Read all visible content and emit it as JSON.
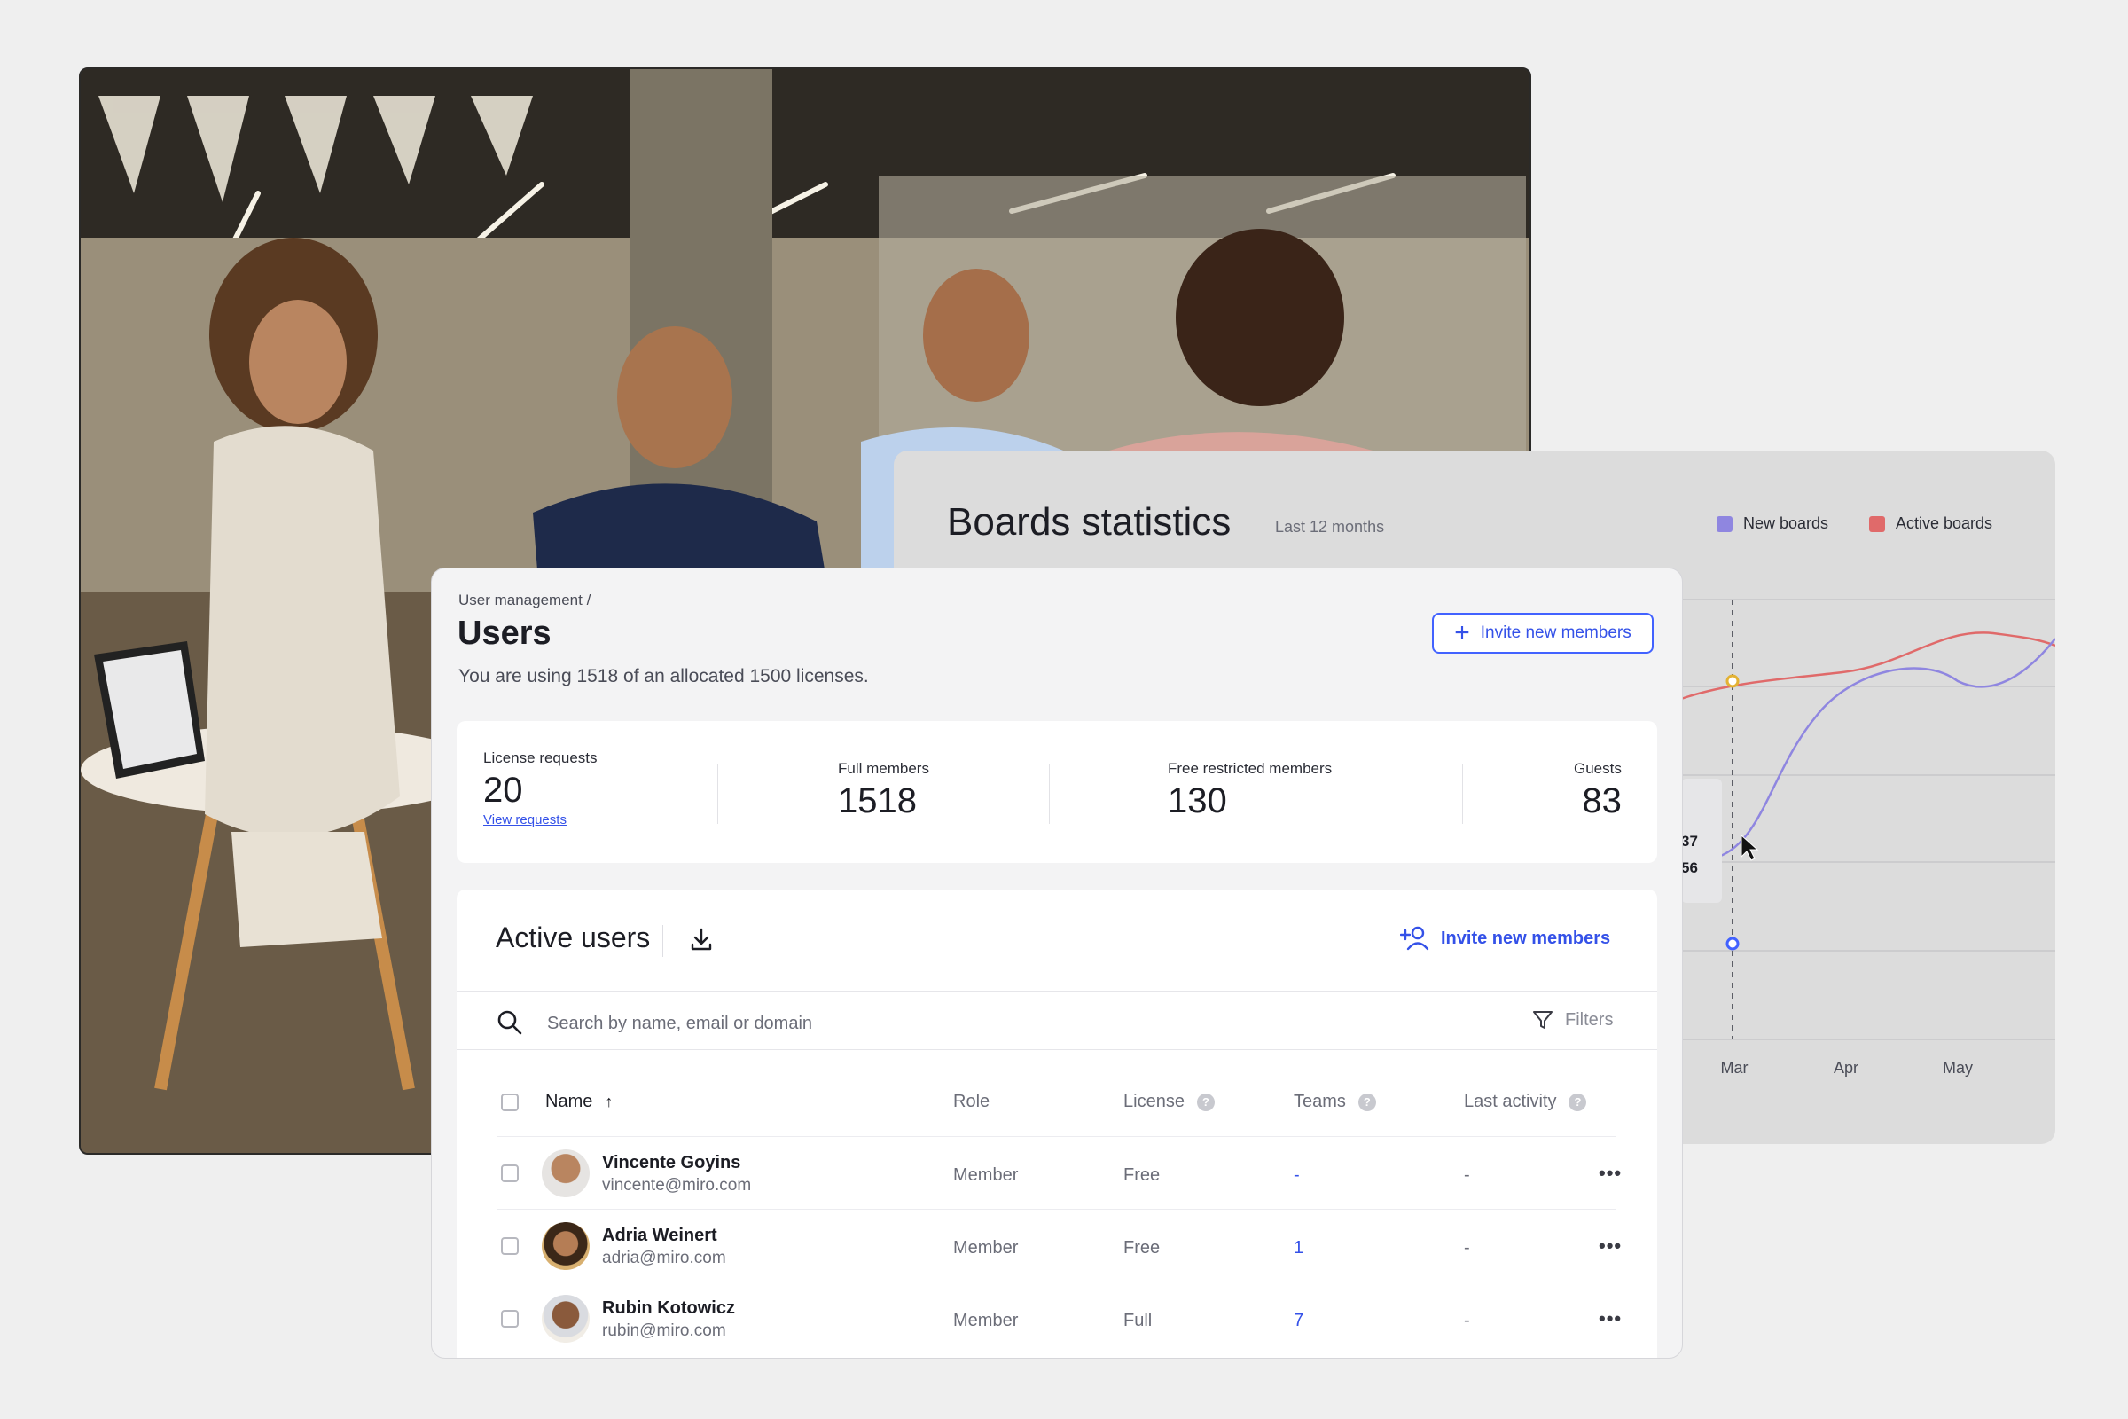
{
  "stats": {
    "title": "Boards statistics",
    "subtitle": "Last 12 months",
    "legend": [
      {
        "label": "New boards",
        "color": "#8f86e0"
      },
      {
        "label": "Active boards",
        "color": "#e06a6a"
      }
    ],
    "months": [
      "Mar",
      "Apr",
      "May"
    ],
    "tooltip_values": [
      "37",
      "56"
    ]
  },
  "breadcrumb": "User management /",
  "page_title": "Users",
  "license_text": "You are using 1518 of an allocated 1500 licenses.",
  "invite_button": "Invite new members",
  "summary": {
    "license_requests": {
      "label": "License requests",
      "value": "20",
      "link": "View requests"
    },
    "full_members": {
      "label": "Full members",
      "value": "1518"
    },
    "free_restricted": {
      "label": "Free restricted members",
      "value": "130"
    },
    "guests": {
      "label": "Guests",
      "value": "83"
    }
  },
  "active_users": {
    "title": "Active users",
    "invite_link": "Invite new members",
    "search_placeholder": "Search by name, email or domain",
    "filters_label": "Filters",
    "columns": {
      "name": "Name",
      "role": "Role",
      "license": "License",
      "teams": "Teams",
      "last_activity": "Last activity"
    },
    "rows": [
      {
        "name": "Vincente Goyins",
        "email": "vincente@miro.com",
        "role": "Member",
        "license": "Free",
        "teams": "-",
        "last_activity": "-"
      },
      {
        "name": "Adria Weinert",
        "email": "adria@miro.com",
        "role": "Member",
        "license": "Free",
        "teams": "1",
        "last_activity": "-"
      },
      {
        "name": "Rubin Kotowicz",
        "email": "rubin@miro.com",
        "role": "Member",
        "license": "Full",
        "teams": "7",
        "last_activity": "-"
      }
    ]
  },
  "colors": {
    "accent": "#4262ff",
    "new_boards": "#8f86e0",
    "active_boards": "#e06a6a"
  }
}
